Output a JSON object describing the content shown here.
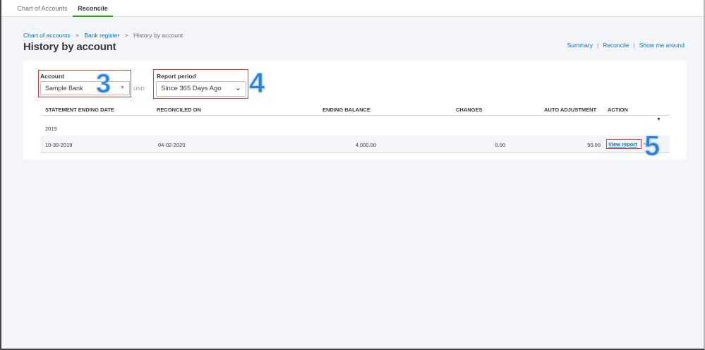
{
  "tabs": [
    {
      "label": "Chart of Accounts",
      "active": false
    },
    {
      "label": "Reconcile",
      "active": true
    }
  ],
  "breadcrumb": {
    "items": [
      "Chart of accounts",
      "Bank register"
    ],
    "current": "History by account",
    "separator": ">"
  },
  "page_title": "History by account",
  "header_links": [
    "Summary",
    "Reconcile",
    "Show me around"
  ],
  "filters": {
    "account_label": "Account",
    "account_value": "Sample Bank",
    "currency": "USD",
    "period_label": "Report period",
    "period_value": "Since 365 Days Ago"
  },
  "annotations": [
    "3",
    "4",
    "5"
  ],
  "table": {
    "columns": [
      "STATEMENT ENDING DATE",
      "RECONCILED ON",
      "ENDING BALANCE",
      "CHANGES",
      "AUTO ADJUSTMENT",
      "ACTION"
    ],
    "group": "2019",
    "rows": [
      {
        "statement_date": "10-30-2019",
        "reconciled_on": "04-02-2020",
        "ending_balance": "4,000.00",
        "changes": "0.00",
        "auto_adjustment": "50.00",
        "action": "View report"
      }
    ]
  },
  "colors": {
    "accent": "#0077c5",
    "tab_active": "#2ca01c",
    "highlight": "#e23b3b",
    "annotation": "#2e7fd6"
  }
}
